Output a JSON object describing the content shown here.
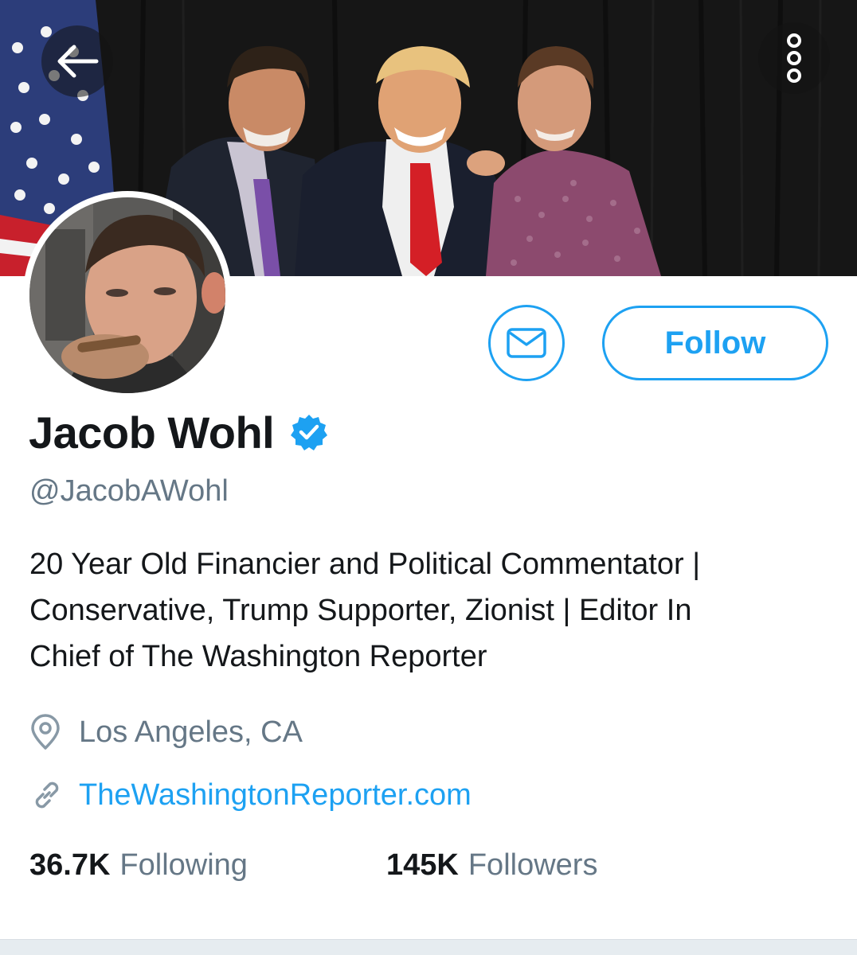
{
  "profile": {
    "display_name": "Jacob Wohl",
    "verified": true,
    "handle": "@JacobAWohl",
    "bio_lines": [
      "20 Year Old Financier and Political Commentator |",
      "Conservative, Trump Supporter, Zionist | Editor In",
      "Chief of The Washington Reporter"
    ],
    "location": "Los Angeles, CA",
    "website": "TheWashingtonReporter.com"
  },
  "actions": {
    "follow_label": "Follow"
  },
  "stats": {
    "following_count": "36.7K",
    "following_label": "Following",
    "followers_count": "145K",
    "followers_label": "Followers"
  },
  "icons": {
    "back": "arrow-left-icon",
    "more": "more-vertical-icon",
    "message": "envelope-icon",
    "verified": "verified-badge-icon",
    "location": "map-pin-icon",
    "website": "link-icon"
  },
  "colors": {
    "accent": "#1da1f2",
    "text_primary": "#14171a",
    "text_secondary": "#657786",
    "footer": "#e6ecf0"
  }
}
